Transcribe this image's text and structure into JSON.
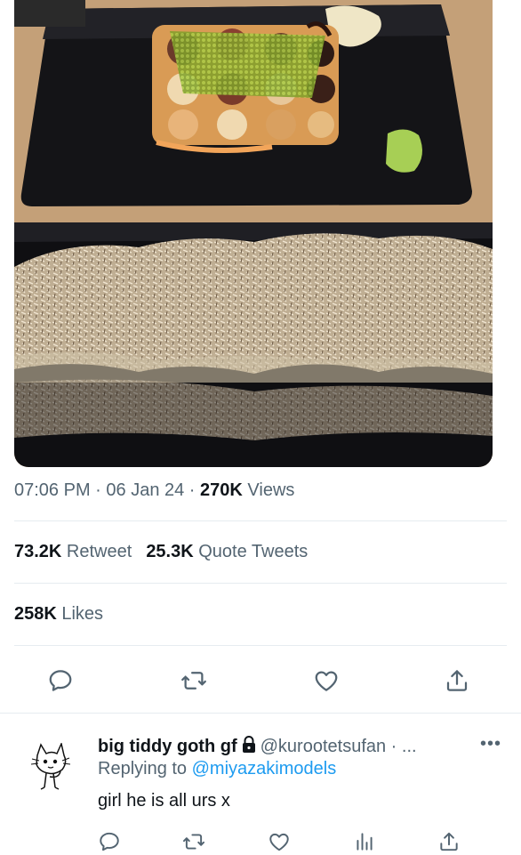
{
  "photo": {
    "description_icon": "sushi-photo",
    "colors": {
      "table": "#c9a77f",
      "plate": "#111114",
      "roll_topping": "#d8cbb5",
      "tobiko": "#9fc23a",
      "sauce": "#f2a55a"
    }
  },
  "tweet": {
    "time": "07:06 PM",
    "sep1": " · ",
    "date": "06 Jan 24",
    "sep2": " · ",
    "views_count": "270K",
    "views_label": " Views",
    "retweets_count": "73.2K",
    "retweets_label": " Retweet",
    "quotes_count": "25.3K",
    "quotes_label": " Quote Tweets",
    "likes_count": "258K",
    "likes_label": " Likes",
    "actions": [
      "reply-icon",
      "retweet-icon",
      "like-icon",
      "share-icon"
    ]
  },
  "reply": {
    "display_name": "big tiddy goth gf",
    "handle": "@kurootetsufan",
    "handle_suffix": " · ...",
    "more": "•••",
    "replying_prefix": "Replying to ",
    "replying_to": "@miyazakimodels",
    "text": "girl he is all urs x",
    "actions": [
      "reply-icon",
      "retweet-icon",
      "like-icon",
      "views-icon",
      "share-icon"
    ]
  },
  "colors": {
    "text": "#0f1419",
    "muted": "#536471",
    "link": "#1d9bf0",
    "divider": "#e6ecf0"
  }
}
